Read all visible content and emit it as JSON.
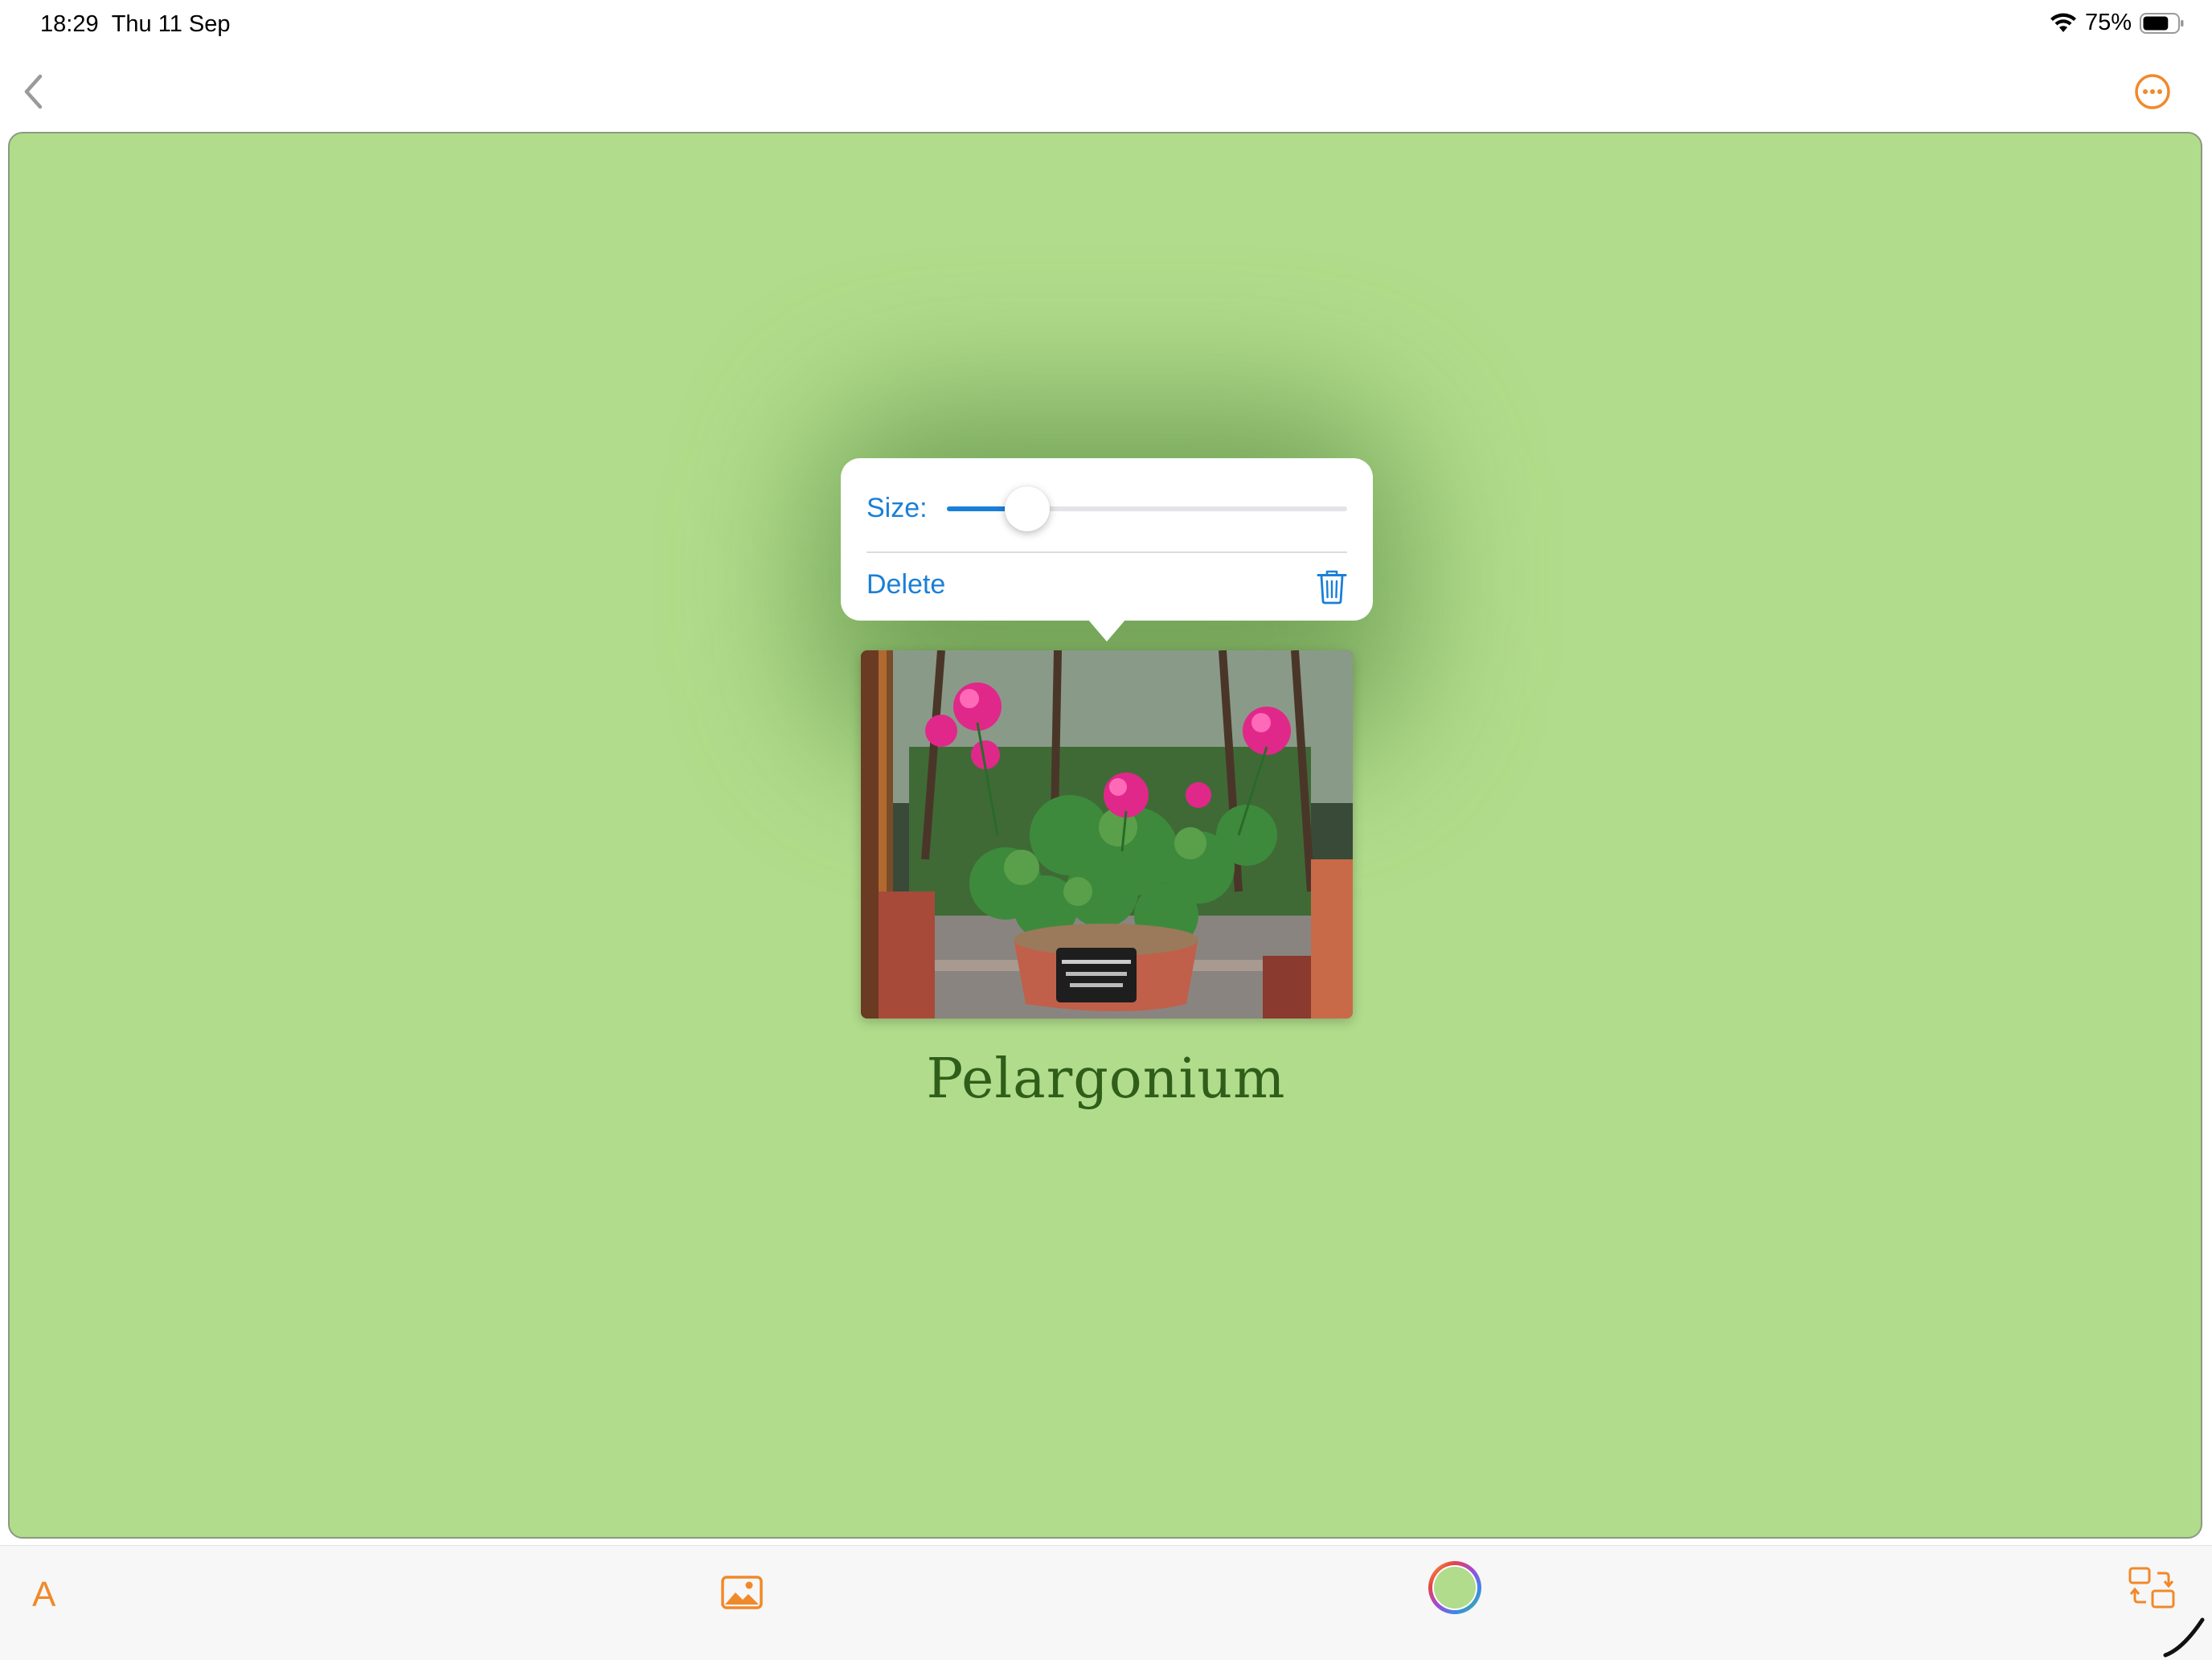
{
  "status_bar": {
    "time": "18:29",
    "date": "Thu 11 Sep",
    "battery": "75%",
    "battery_level": 0.75
  },
  "nav": {
    "back_icon": "chevron-left-icon",
    "more_icon": "ellipsis-circle-icon"
  },
  "colors": {
    "accent": "#f0892a",
    "link_blue": "#1a7fd8",
    "card_background": "#b1dc8b",
    "title_color": "#2f5e1a"
  },
  "popover": {
    "size_label": "Size:",
    "size_value": 0.2,
    "delete_label": "Delete",
    "delete_icon": "trash-icon"
  },
  "card": {
    "title": "Pelargonium",
    "photo_icon": "photo-flowers"
  },
  "toolbar": {
    "text_button": "A",
    "image_icon": "image-icon",
    "color_icon": "color-wheel-icon",
    "layout_icon": "swap-layout-icon"
  }
}
